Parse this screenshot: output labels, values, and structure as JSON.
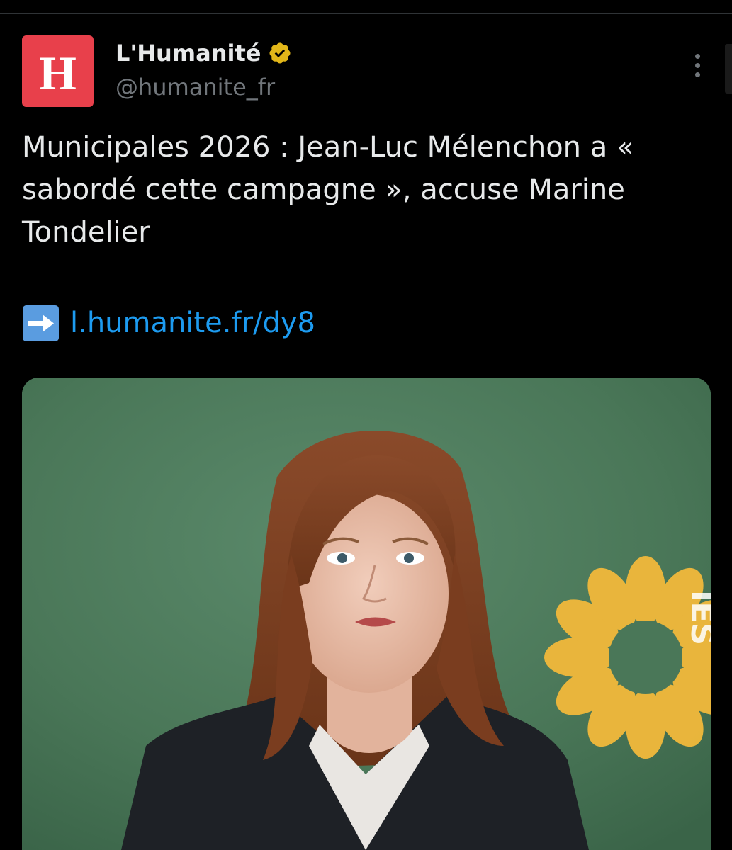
{
  "author": {
    "avatar_letter": "H",
    "display_name": "L'Humanité",
    "handle": "@humanite_fr",
    "verified_badge_color": "#e2b719",
    "avatar_color": "#e8404b"
  },
  "tweet": {
    "text": "Municipales 2026 : Jean-Luc Mélenchon a « sabordé cette campagne », accuse Marine Tondelier",
    "link_icon": "right-arrow-emoji",
    "link_text": "l.humanite.fr/dy8",
    "link_color": "#1d9bf0"
  },
  "media": {
    "watermark_text": "IES",
    "background_color": "#4d7a5d",
    "sunflower_color": "#f2b93b"
  },
  "menu": {
    "icon": "more-vertical-icon"
  }
}
